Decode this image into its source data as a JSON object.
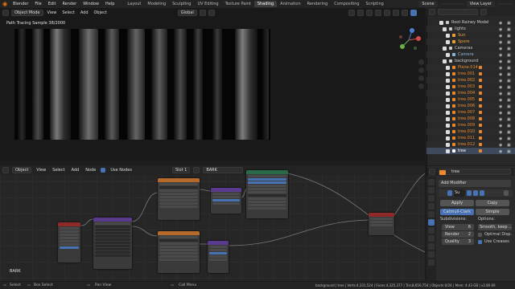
{
  "topbar": {
    "menus": [
      "Blender",
      "File",
      "Edit",
      "Render",
      "Window",
      "Help"
    ],
    "workspaces": [
      {
        "label": "Layout",
        "active": false
      },
      {
        "label": "Modeling",
        "active": false
      },
      {
        "label": "Sculpting",
        "active": false
      },
      {
        "label": "UV Editing",
        "active": false
      },
      {
        "label": "Texture Paint",
        "active": false
      },
      {
        "label": "Shading",
        "active": true
      },
      {
        "label": "Animation",
        "active": false
      },
      {
        "label": "Rendering",
        "active": false
      },
      {
        "label": "Compositing",
        "active": false
      },
      {
        "label": "Scripting",
        "active": false
      }
    ],
    "scene": "Scene",
    "view_layer": "View Layer"
  },
  "viewport": {
    "mode": "Object Mode",
    "menus": [
      "View",
      "Select",
      "Add",
      "Object"
    ],
    "transform": "Global",
    "status_text": "Path Tracing Sample 38/2000"
  },
  "outliner": {
    "rows": [
      {
        "label": "Root Rainey Model",
        "indent": 0,
        "icon": "collection-icon",
        "color": "#cccccc",
        "extra": false
      },
      {
        "label": "lights",
        "indent": 1,
        "icon": "collection-icon",
        "color": "#cccccc",
        "extra": false
      },
      {
        "label": "Sun",
        "indent": 2,
        "icon": "light-icon",
        "color": "#e9a13b",
        "extra": false
      },
      {
        "label": "Spore",
        "indent": 2,
        "icon": "light-icon",
        "color": "#e9a13b",
        "extra": false
      },
      {
        "label": "Cameras",
        "indent": 1,
        "icon": "collection-icon",
        "color": "#cccccc",
        "extra": false
      },
      {
        "label": "Camera",
        "indent": 2,
        "icon": "camera-icon",
        "color": "#8ab4d9",
        "extra": false
      },
      {
        "label": "background",
        "indent": 1,
        "icon": "collection-icon",
        "color": "#cccccc",
        "extra": false
      },
      {
        "label": "Plane.014",
        "indent": 2,
        "icon": "mesh-icon",
        "color": "#e98a2f",
        "extra": true
      },
      {
        "label": "tree.001",
        "indent": 2,
        "icon": "mesh-icon",
        "color": "#e98a2f",
        "extra": true
      },
      {
        "label": "tree.002",
        "indent": 2,
        "icon": "mesh-icon",
        "color": "#e98a2f",
        "extra": true
      },
      {
        "label": "tree.003",
        "indent": 2,
        "icon": "mesh-icon",
        "color": "#e98a2f",
        "extra": true
      },
      {
        "label": "tree.004",
        "indent": 2,
        "icon": "mesh-icon",
        "color": "#e98a2f",
        "extra": true
      },
      {
        "label": "tree.005",
        "indent": 2,
        "icon": "mesh-icon",
        "color": "#e98a2f",
        "extra": true
      },
      {
        "label": "tree.006",
        "indent": 2,
        "icon": "mesh-icon",
        "color": "#e98a2f",
        "extra": true
      },
      {
        "label": "tree.007",
        "indent": 2,
        "icon": "mesh-icon",
        "color": "#e98a2f",
        "extra": true
      },
      {
        "label": "tree.008",
        "indent": 2,
        "icon": "mesh-icon",
        "color": "#e98a2f",
        "extra": true
      },
      {
        "label": "tree.009",
        "indent": 2,
        "icon": "mesh-icon",
        "color": "#e98a2f",
        "extra": true
      },
      {
        "label": "tree.010",
        "indent": 2,
        "icon": "mesh-icon",
        "color": "#e98a2f",
        "extra": true
      },
      {
        "label": "tree.011",
        "indent": 2,
        "icon": "mesh-icon",
        "color": "#e98a2f",
        "extra": true
      },
      {
        "label": "tree.012",
        "indent": 2,
        "icon": "mesh-icon",
        "color": "#e98a2f",
        "extra": true
      },
      {
        "label": "tree",
        "indent": 2,
        "icon": "mesh-icon",
        "color": "#ffffff",
        "extra": true
      }
    ]
  },
  "properties": {
    "object_name": "tree",
    "add_modifier": "Add Modifier",
    "modifier_name": "Su",
    "apply": "Apply",
    "copy": "Copy",
    "catmull": "Catmull-Clark",
    "simple": "Simple",
    "subdivisions": "Subdivisions:",
    "options": "Options:",
    "view_label": "View",
    "view_value": "6",
    "render_label": "Render",
    "render_value": "2",
    "quality_label": "Quality",
    "quality_value": "3",
    "smooth": "Smooth, keep ...",
    "optimal": "Optimal Disp.",
    "use_creases": "Use Creases"
  },
  "node_editor": {
    "type": "Object",
    "menus": [
      "View",
      "Select",
      "Add",
      "Node"
    ],
    "use_nodes": "Use Nodes",
    "slot": "Slot 1",
    "material": "BARK",
    "material_label": "BARK"
  },
  "statusbar": {
    "select": "Select",
    "box_select": "Box Select",
    "pan_view": "Pan View",
    "call_menu": "Call Menu",
    "stats": "background | tree | Verts:4,331,524 | Faces:4,325,377 | Tris:8,650,754 | Objects:0/26 | Mem: 4.43 GB | v2.80.69"
  },
  "colors": {
    "accent": "#4772b3",
    "object_orange": "#e98a2f",
    "logo": "#e87d0d"
  }
}
